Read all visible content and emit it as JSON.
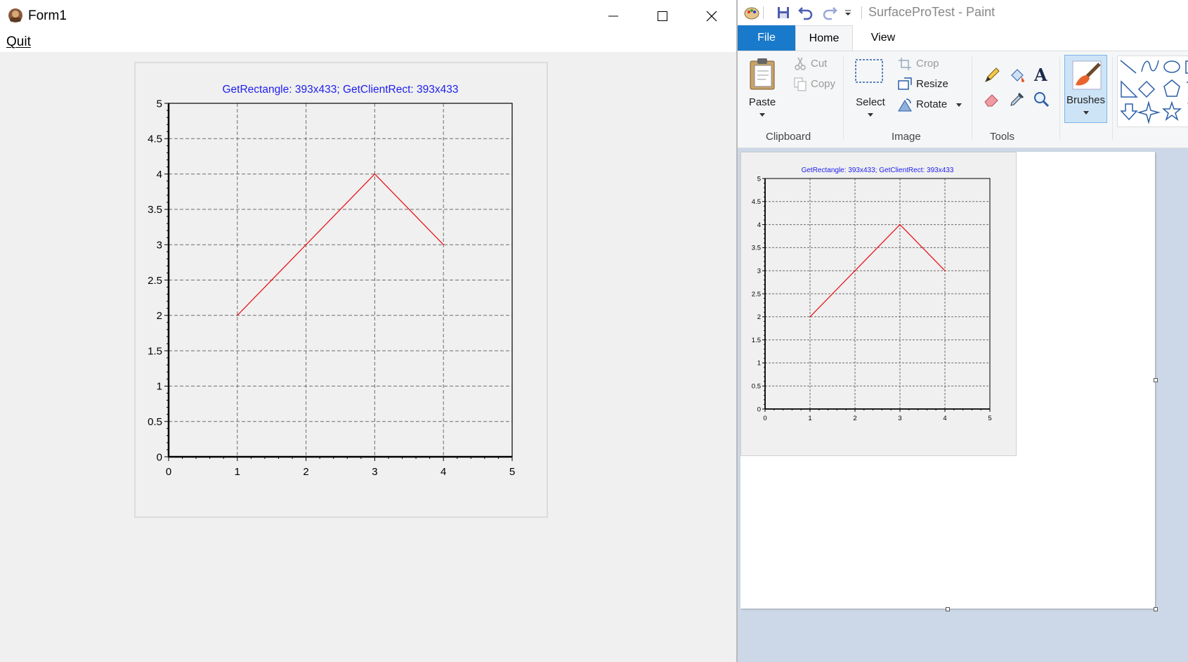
{
  "form1": {
    "title": "Form1",
    "menu": {
      "quit": "Quit"
    },
    "chart": {
      "title": "GetRectangle: 393x433; GetClientRect: 393x433"
    }
  },
  "paint": {
    "title": "SurfaceProTest - Paint",
    "tabs": {
      "file": "File",
      "home": "Home",
      "view": "View"
    },
    "clipboard": {
      "paste": "Paste",
      "cut": "Cut",
      "copy": "Copy",
      "group": "Clipboard"
    },
    "image": {
      "select": "Select",
      "crop": "Crop",
      "resize": "Resize",
      "rotate": "Rotate",
      "group": "Image"
    },
    "tools": {
      "group": "Tools"
    },
    "brushes": "Brushes",
    "canvas_chart_title": "GetRectangle: 393x433; GetClientRect: 393x433"
  },
  "colors": {
    "series": "#e8141a",
    "title": "#2020ee",
    "paint_file_tab": "#1979ca"
  },
  "chart_data": [
    {
      "type": "line",
      "title": "GetRectangle: 393x433; GetClientRect: 393x433",
      "xlim": [
        0,
        5
      ],
      "ylim": [
        0,
        5
      ],
      "xticks": [
        0,
        1,
        2,
        3,
        4,
        5
      ],
      "yticks": [
        0,
        0.5,
        1,
        1.5,
        2,
        2.5,
        3,
        3.5,
        4,
        4.5,
        5
      ],
      "grid": true,
      "series": [
        {
          "x": [
            1,
            2,
            3,
            4
          ],
          "y": [
            2,
            3,
            4,
            3
          ]
        }
      ]
    },
    {
      "type": "line",
      "title": "GetRectangle: 393x433; GetClientRect: 393x433",
      "xlim": [
        0,
        5
      ],
      "ylim": [
        0,
        5
      ],
      "xticks": [
        0,
        1,
        2,
        3,
        4,
        5
      ],
      "yticks": [
        0,
        0.5,
        1,
        1.5,
        2,
        2.5,
        3,
        3.5,
        4,
        4.5,
        5
      ],
      "grid": true,
      "series": [
        {
          "x": [
            1,
            2,
            3,
            4
          ],
          "y": [
            2,
            3,
            4,
            3
          ]
        }
      ]
    }
  ]
}
